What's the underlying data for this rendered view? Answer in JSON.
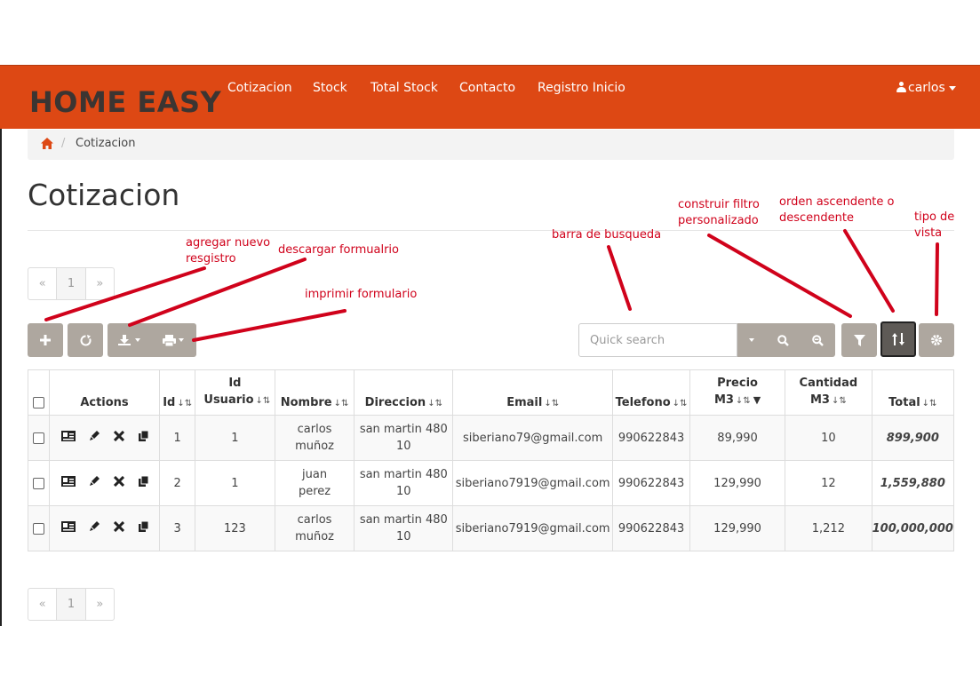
{
  "brand": "HOME EASY",
  "nav": {
    "items": [
      "Cotizacion",
      "Stock",
      "Total Stock",
      "Contacto",
      "Registro Inicio"
    ],
    "user": "carlos"
  },
  "breadcrumb": {
    "current": "Cotizacion"
  },
  "page_title": "Cotizacion",
  "pagination": {
    "prev": "«",
    "page": "1",
    "next": "»"
  },
  "search": {
    "placeholder": "Quick search"
  },
  "toolbar": {
    "icons": [
      "plus-icon",
      "refresh-icon",
      "export-icon",
      "print-icon",
      "caret-down-icon",
      "search-icon",
      "zoom-out-icon",
      "filter-icon",
      "sort-icon",
      "gear-icon"
    ]
  },
  "table": {
    "columns": [
      "Actions",
      "Id",
      "Id Usuario",
      "Nombre",
      "Direccion",
      "Email",
      "Telefono",
      "Precio M3",
      "Cantidad M3",
      "Total"
    ],
    "rows": [
      {
        "id": "1",
        "id_usuario": "1",
        "nombre": "carlos muñoz",
        "direccion": "san martin 480 10",
        "email": "siberiano79@gmail.com",
        "telefono": "990622843",
        "precio": "89,990",
        "cantidad": "10",
        "total": "899,900"
      },
      {
        "id": "2",
        "id_usuario": "1",
        "nombre": "juan perez",
        "direccion": "san martin 480 10",
        "email": "siberiano7919@gmail.com",
        "telefono": "990622843",
        "precio": "129,990",
        "cantidad": "12",
        "total": "1,559,880"
      },
      {
        "id": "3",
        "id_usuario": "123",
        "nombre": "carlos muñoz",
        "direccion": "san martin 480 10",
        "email": "siberiano7919@gmail.com",
        "telefono": "990622843",
        "precio": "129,990",
        "cantidad": "1,212",
        "total": "100,000,000"
      }
    ]
  },
  "annotations": {
    "agregar": "agregar nuevo\nresgistro",
    "descargar": "descargar formualrio",
    "imprimir": "imprimir formulario",
    "barra": "barra de busqueda",
    "filtro": "construir filtro\npersonalizado",
    "orden": "orden ascendente o\ndescendente",
    "tipo": "tipo de\nvista"
  },
  "colors": {
    "navbar": "#dd4814",
    "button": "#aea79f",
    "annotation": "#d0021b",
    "brand_text": "#3b3532"
  }
}
